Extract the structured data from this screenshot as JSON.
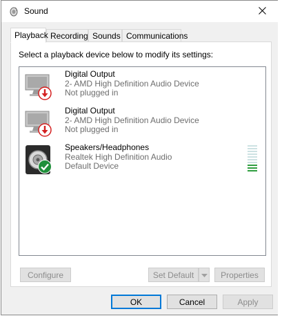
{
  "window": {
    "title": "Sound",
    "icon": "speaker-icon",
    "close_icon": "close-icon"
  },
  "tabs": [
    {
      "label": "Playback",
      "active": true
    },
    {
      "label": "Recording",
      "active": false
    },
    {
      "label": "Sounds",
      "active": false
    },
    {
      "label": "Communications",
      "active": false
    }
  ],
  "instruction": "Select a playback device below to modify its settings:",
  "devices": [
    {
      "name": "Digital Output",
      "driver": "2- AMD High Definition Audio Device",
      "status": "Not plugged in",
      "icon": "monitor-speaker-icon",
      "badge": "unplugged-arrow-icon",
      "badge_color": "#d42020"
    },
    {
      "name": "Digital Output",
      "driver": "2- AMD High Definition Audio Device",
      "status": "Not plugged in",
      "icon": "monitor-speaker-icon",
      "badge": "unplugged-arrow-icon",
      "badge_color": "#d42020"
    },
    {
      "name": "Speakers/Headphones",
      "driver": "Realtek High Definition Audio",
      "status": "Default Device",
      "icon": "speaker-icon",
      "badge": "default-check-icon",
      "badge_color": "#1f8f3a",
      "level_meter": {
        "segments": 10,
        "active": 3,
        "active_color": "#2f9e3f"
      }
    }
  ],
  "buttons": {
    "configure": "Configure",
    "set_default": "Set Default",
    "properties": "Properties",
    "ok": "OK",
    "cancel": "Cancel",
    "apply": "Apply"
  },
  "colors": {
    "accent": "#0078d7",
    "disabled_text": "#8c8c8c",
    "secondary_text": "#6d6d6d"
  }
}
